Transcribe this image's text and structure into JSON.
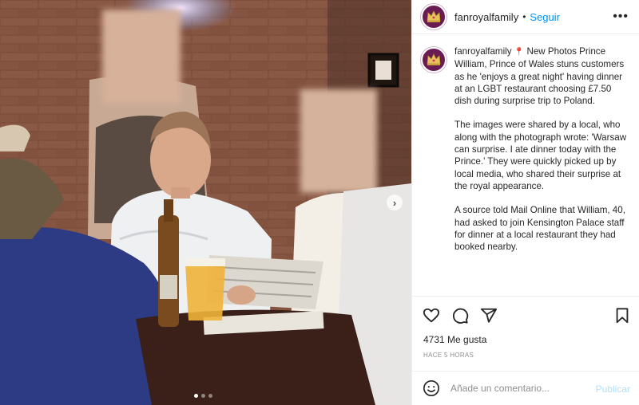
{
  "post": {
    "username": "fanroyalfamily",
    "separator": "•",
    "follow_label": "Seguir",
    "more_icon": "more-options-icon",
    "caption": {
      "username": "fanroyalfamily",
      "pin_icon": "📍",
      "paragraph_1": "New Photos Prince William, Prince of Wales stuns customers as he 'enjoys a great night' having dinner at an LGBT restaurant choosing £7.50 dish during surprise trip to Poland.",
      "paragraph_2": "The images were shared by a local, who along with the photograph wrote: 'Warsaw can surprise. I ate dinner today with the Prince.' They were quickly picked up by local media, who shared their surprise at the royal appearance.",
      "paragraph_3": "A source told Mail Online that William, 40, had asked to join Kensington Palace staff for dinner at a local restaurant they had booked nearby."
    },
    "likes": "4731 Me gusta",
    "timestamp": "HACE 5 HORAS",
    "carousel": {
      "slides": 3,
      "active": 1
    }
  },
  "comment": {
    "placeholder": "Añade un comentario...",
    "publish_label": "Publicar"
  },
  "colors": {
    "link_blue": "#0095f6",
    "publish_disabled": "#b2dffc",
    "avatar_bg": "#6a1b52"
  }
}
